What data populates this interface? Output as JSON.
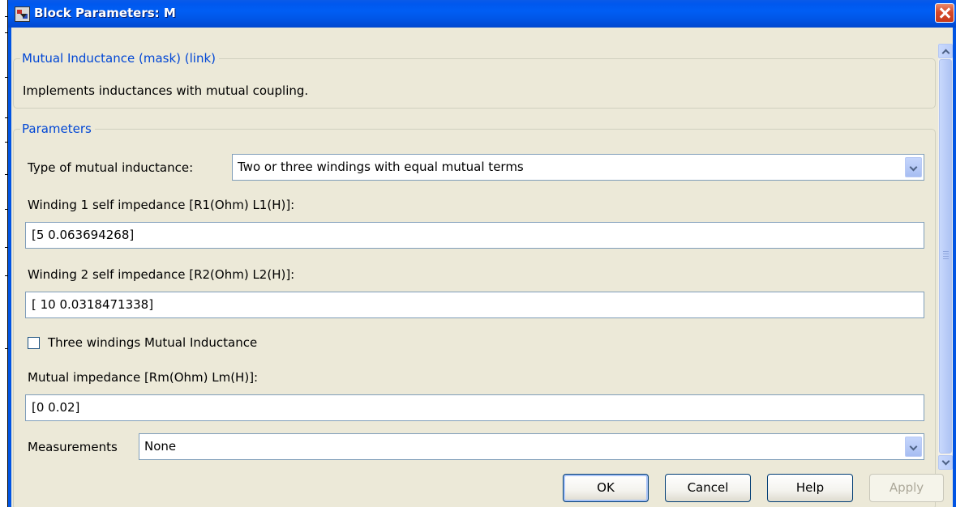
{
  "window": {
    "title": "Block Parameters: M"
  },
  "mask_group": {
    "legend": "Mutual Inductance (mask) (link)",
    "description": "Implements inductances with mutual coupling."
  },
  "parameters_group": {
    "legend": "Parameters",
    "type_label": "Type of mutual inductance:",
    "type_value": "Two or three windings with equal mutual terms",
    "winding1_label": "Winding 1 self impedance [R1(Ohm) L1(H)]:",
    "winding1_value": "[5 0.063694268]",
    "winding2_label": "Winding 2 self impedance [R2(Ohm) L2(H)]:",
    "winding2_value": "[ 10 0.0318471338]",
    "three_windings_label": "Three windings Mutual Inductance",
    "three_windings_checked": false,
    "mutual_label": "Mutual impedance [Rm(Ohm) Lm(H)]:",
    "mutual_value": "[0 0.02]",
    "measurements_label": "Measurements",
    "measurements_value": "None"
  },
  "buttons": {
    "ok": "OK",
    "cancel": "Cancel",
    "help": "Help",
    "apply": "Apply"
  },
  "colors": {
    "titlebar": "#0054e3",
    "client_bg": "#ece9d8",
    "legend_text": "#0046d5",
    "close_button": "#d6492a"
  },
  "icons": {
    "title": "simulink-block-icon",
    "close": "close-icon",
    "dropdown": "chevron-down-icon",
    "scroll_up": "scroll-up-arrow-icon",
    "scroll_down": "scroll-down-arrow-icon"
  }
}
